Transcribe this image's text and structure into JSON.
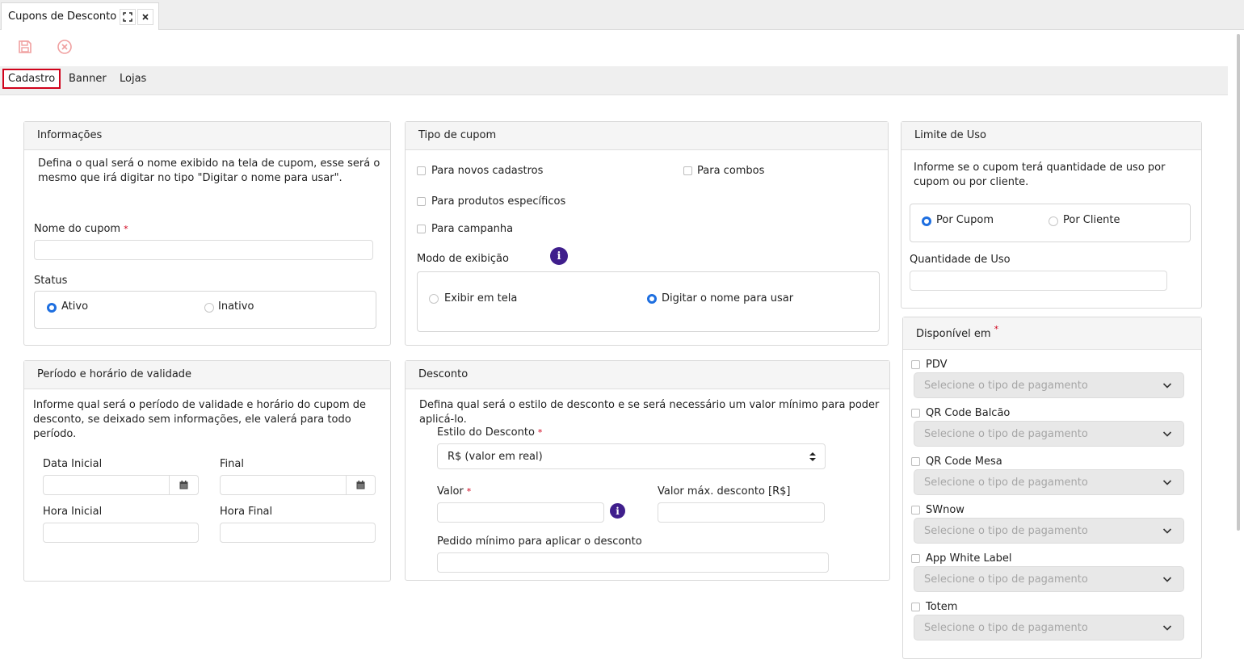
{
  "colors": {
    "accent": "#1e6fe0",
    "required": "#d0021b",
    "info": "#3f1e8c",
    "toolbar_icon": "#f0a0a0"
  },
  "window": {
    "tab_title": "Cupons de Desconto",
    "expand_icon": "expand-icon",
    "close_icon": "close-icon"
  },
  "toolbar": {
    "save_icon": "save-icon",
    "cancel_icon": "cancel-circle-icon"
  },
  "tabs": [
    {
      "label": "Cadastro",
      "active": true
    },
    {
      "label": "Banner",
      "active": false
    },
    {
      "label": "Lojas",
      "active": false
    }
  ],
  "informacoes": {
    "title": "Informações",
    "desc_line1": "Defina o qual será o nome exibido na tela de cupom, esse será o",
    "desc_line2": "mesmo que irá digitar no tipo \"Digitar o nome para usar\".",
    "nome_label": "Nome do cupom",
    "required_mark": "*",
    "nome_value": "",
    "status_label": "Status",
    "status_options": [
      {
        "label": "Ativo",
        "selected": true
      },
      {
        "label": "Inativo",
        "selected": false
      }
    ]
  },
  "tipo_cupom": {
    "title": "Tipo de cupom",
    "options": [
      {
        "label": "Para novos cadastros",
        "checked": false
      },
      {
        "label": "Para combos",
        "checked": false
      },
      {
        "label": "Para produtos específicos",
        "checked": false
      },
      {
        "label": "Para campanha",
        "checked": false
      }
    ],
    "modo_label": "Modo de exibição",
    "info_glyph": "i",
    "modo_options": [
      {
        "label": "Exibir em tela",
        "selected": false
      },
      {
        "label": "Digitar o nome para usar",
        "selected": true
      }
    ]
  },
  "limite": {
    "title": "Limite de Uso",
    "desc_line1": "Informe se o cupom terá quantidade de uso por",
    "desc_line2": "cupom ou por cliente.",
    "options": [
      {
        "label": "Por Cupom",
        "selected": true
      },
      {
        "label": "Por Cliente",
        "selected": false
      }
    ],
    "quantidade_label": "Quantidade de Uso",
    "quantidade_value": ""
  },
  "periodo": {
    "title": "Período e horário de validade",
    "desc_line1": "Informe qual será o período de validade e horário do cupom de",
    "desc_line2": "desconto, se deixado sem informações, ele valerá para todo",
    "desc_line3": "período.",
    "data_inicial_label": "Data Inicial",
    "final_label": "Final",
    "hora_inicial_label": "Hora Inicial",
    "hora_final_label": "Hora Final",
    "calendar_icon": "calendar-icon"
  },
  "desconto": {
    "title": "Desconto",
    "desc_line1": "Defina qual será o estilo de desconto e se será necessário um valor mínimo para poder",
    "desc_line2": "aplicá-lo.",
    "estilo_label": "Estilo do Desconto",
    "estilo_value": "R$ (valor em real)",
    "valor_label": "Valor",
    "valor_max_label": "Valor máx. desconto [R$]",
    "pedido_label": "Pedido mínimo para aplicar o desconto"
  },
  "disponivel": {
    "title": "Disponível em",
    "placeholder": "Selecione o tipo de pagamento",
    "items": [
      {
        "label": "PDV",
        "checked": false
      },
      {
        "label": "QR Code Balcão",
        "checked": false
      },
      {
        "label": "QR Code Mesa",
        "checked": false
      },
      {
        "label": "SWnow",
        "checked": false
      },
      {
        "label": "App White Label",
        "checked": false
      },
      {
        "label": "Totem",
        "checked": false
      }
    ]
  }
}
